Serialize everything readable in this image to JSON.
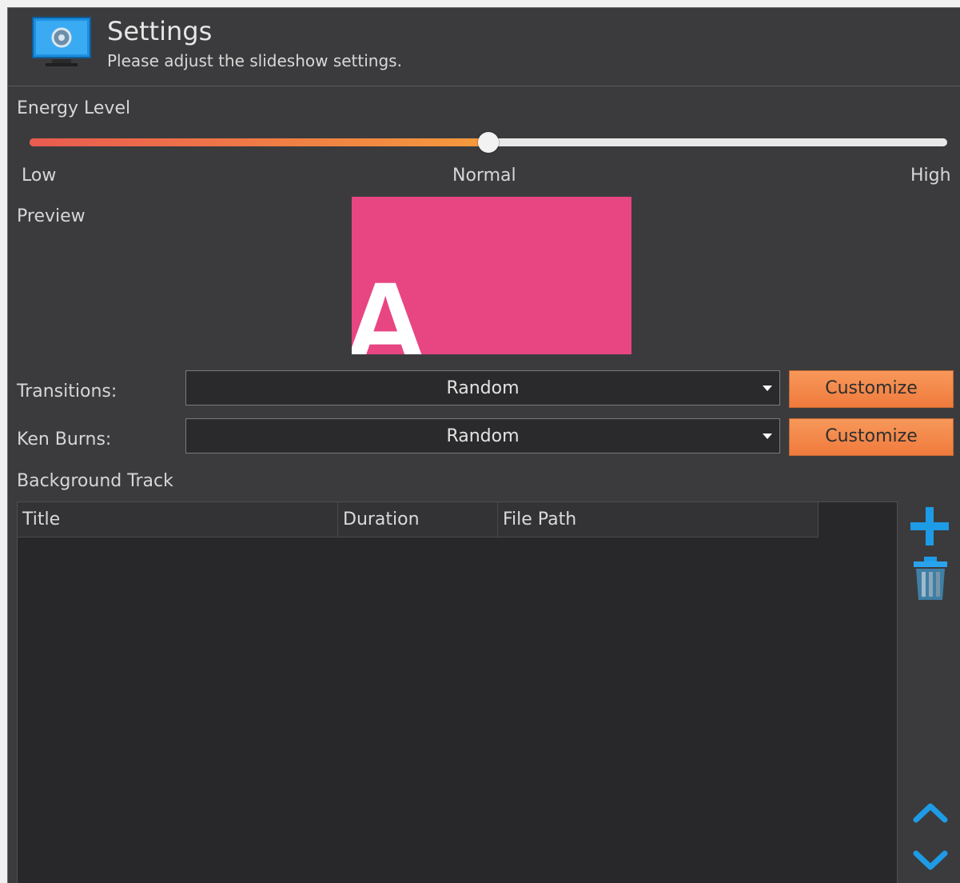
{
  "header": {
    "title": "Settings",
    "subtitle": "Please adjust the slideshow settings."
  },
  "energy": {
    "label": "Energy Level",
    "value_fraction": 0.5,
    "ticks": [
      "Low",
      "Normal",
      "High"
    ]
  },
  "preview": {
    "label": "Preview",
    "letter": "A",
    "background_color": "#e84583"
  },
  "transitions": {
    "label": "Transitions:",
    "value": "Random",
    "button_label": "Customize"
  },
  "ken_burns": {
    "label": "Ken Burns:",
    "value": "Random",
    "button_label": "Customize"
  },
  "background_track": {
    "label": "Background Track",
    "columns": [
      "Title",
      "Duration",
      "File Path"
    ],
    "rows": [],
    "actions": {
      "add_icon": "plus-icon",
      "delete_icon": "trash-icon",
      "up_icon": "chevron-up-icon",
      "down_icon": "chevron-down-icon"
    }
  },
  "colors": {
    "accent_orange": "#f28a48",
    "icon_blue": "#1e9be6",
    "panel_bg": "#3b3b3d"
  }
}
